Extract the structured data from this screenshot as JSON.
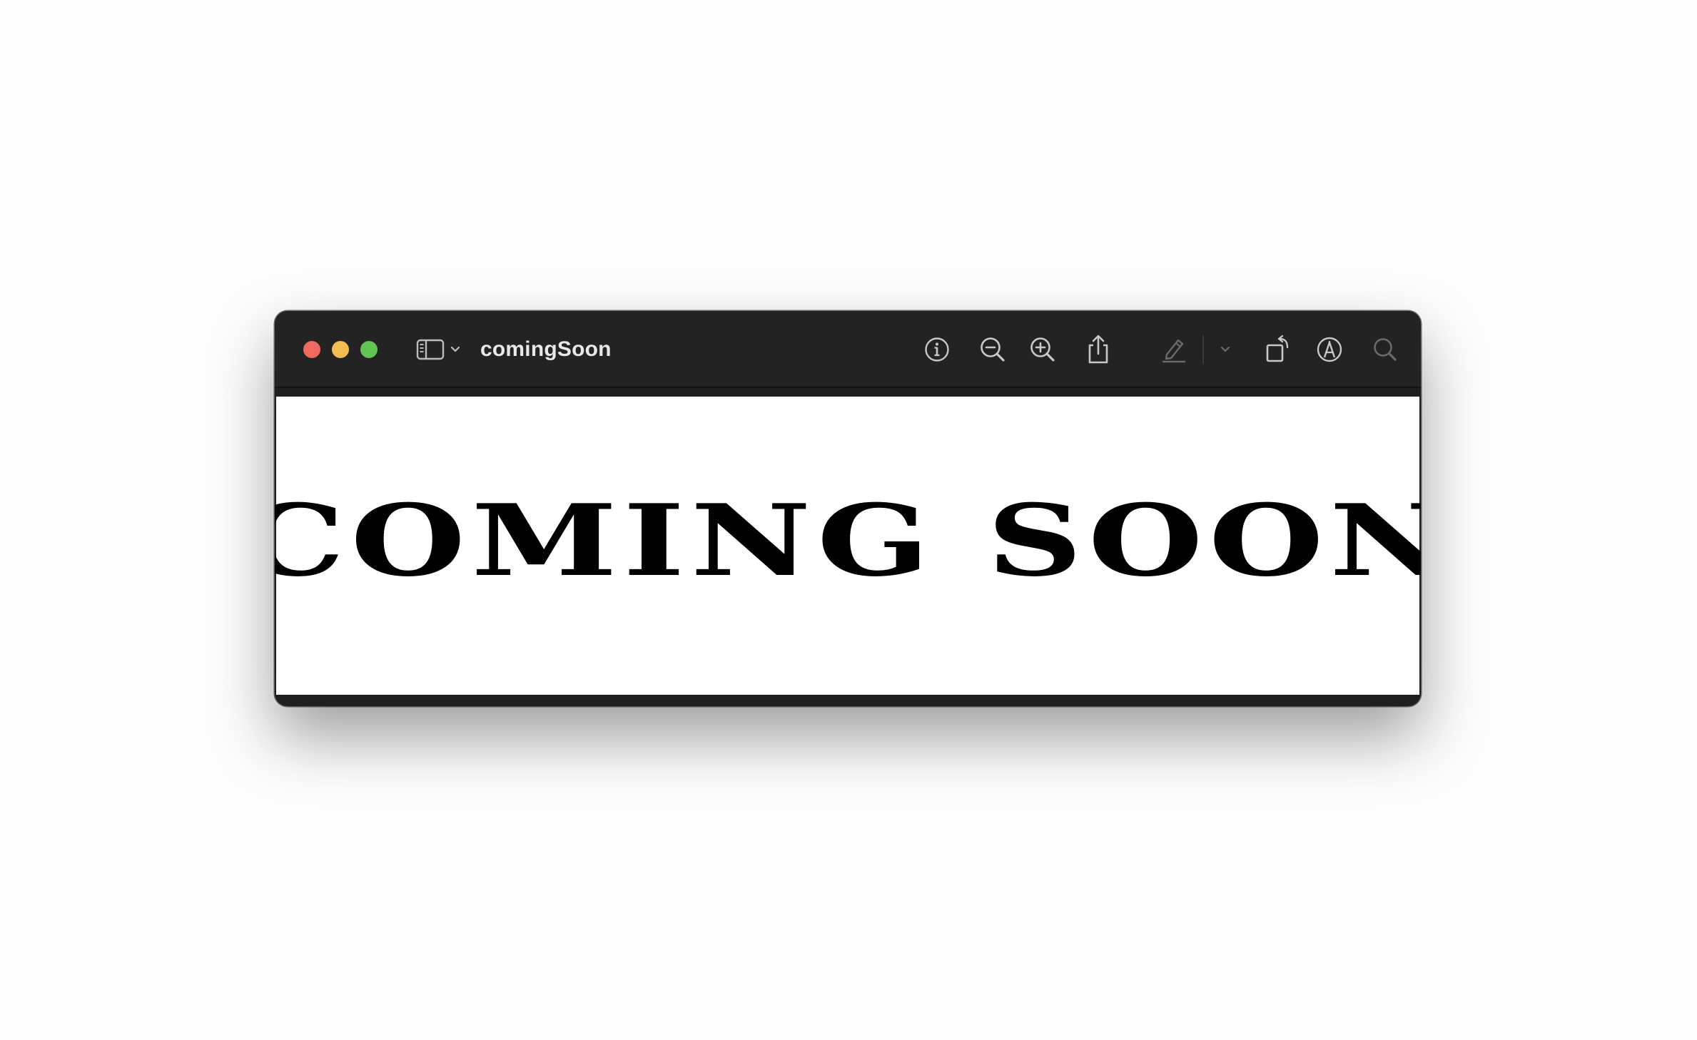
{
  "window": {
    "title": "comingSoon",
    "traffic_lights": {
      "close_color": "#ee6a5f",
      "minimize_color": "#f5bd4f",
      "zoom_color": "#61c454"
    }
  },
  "toolbar": {
    "icons": [
      "sidebar-toggle-icon",
      "chevron-down-icon",
      "info-icon",
      "zoom-out-icon",
      "zoom-in-icon",
      "share-icon",
      "highlight-pen-icon",
      "chevron-down-icon",
      "rotate-icon",
      "markup-icon",
      "search-icon"
    ]
  },
  "document": {
    "headline": "COMING SOON"
  }
}
